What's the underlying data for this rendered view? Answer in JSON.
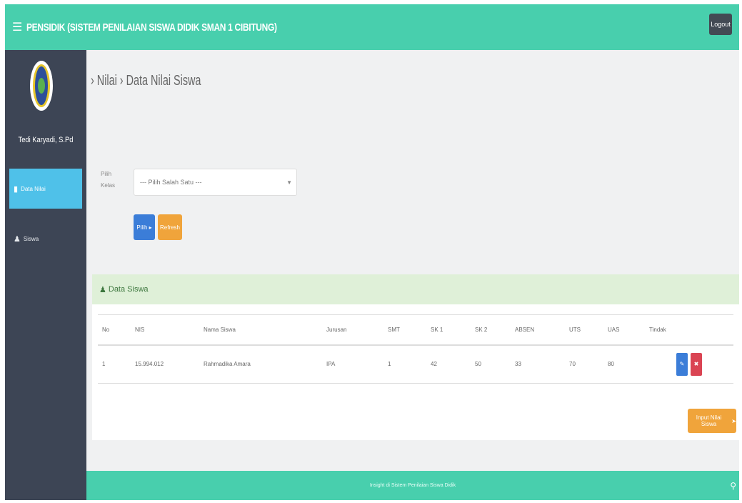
{
  "header": {
    "menu_icon": "hamburger-icon",
    "title": "PENSIDIK (SISTEM PENILAIAN SISWA DIDIK SMAN 1 CIBITUNG)",
    "logout_label": "Logout"
  },
  "colors": {
    "topbar": "#48cfad",
    "sidebar": "#3d4555",
    "active_item": "#4fc1e9",
    "primary": "#3b7dd8",
    "warning": "#f0a43b",
    "danger": "#da4453",
    "panel_header": "#dff0d8"
  },
  "sidebar": {
    "username": "Tedi Karyadi, S.Pd",
    "items": [
      {
        "label": "Data Nilai",
        "icon": "file-icon",
        "active": true
      },
      {
        "label": "Siswa",
        "icon": "user-icon",
        "active": false
      }
    ]
  },
  "main": {
    "breadcrumb": "› Nilai › Data Nilai Siswa",
    "filter": {
      "label_line1": "Pilih",
      "label_line2": "Kelas",
      "select_value": "--- Pilih Salah Satu ---"
    },
    "buttons": {
      "primary": "Pilih ▸",
      "secondary": "Refresh"
    },
    "panel": {
      "icon": "user-icon",
      "title": "Data Siswa",
      "columns": [
        "No",
        "NIS",
        "Nama Siswa",
        "Jurusan",
        "SMT",
        "SK 1",
        "SK 2",
        "ABSEN",
        "UTS",
        "UAS",
        "Tindak"
      ],
      "rows": [
        {
          "no": "1",
          "nis": "15.994.012",
          "nama": "Rahmadika Amara",
          "jurusan": "IPA",
          "smt": "1",
          "sk1": "42",
          "sk2": "50",
          "absen": "33",
          "uts": "70",
          "uas": "80"
        }
      ],
      "row_actions": {
        "edit_icon": "edit-icon",
        "delete_icon": "trash-icon"
      },
      "input_button": "Input Nilai Siswa"
    }
  },
  "footer": {
    "text": "Insight di Sistem Penilaian Siswa Didik",
    "icon": "location-pin-icon"
  }
}
